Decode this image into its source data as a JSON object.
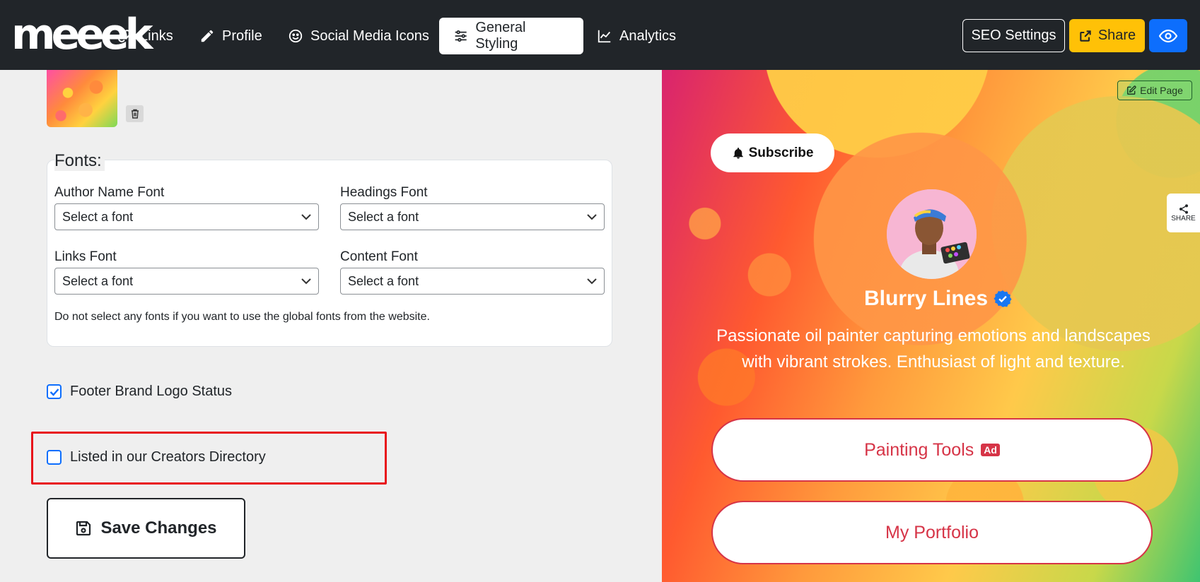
{
  "app": {
    "logo_text": "meeek"
  },
  "nav": {
    "links": "Links",
    "profile": "Profile",
    "social_media_icons": "Social Media Icons",
    "general_styling": "General Styling",
    "analytics": "Analytics"
  },
  "toolbar": {
    "seo_settings": "SEO Settings",
    "share": "Share"
  },
  "fonts": {
    "legend": "Fonts:",
    "author_name_label": "Author Name Font",
    "author_name_value": "Select a font",
    "headings_label": "Headings Font",
    "headings_value": "Select a font",
    "links_label": "Links Font",
    "links_value": "Select a font",
    "content_label": "Content Font",
    "content_value": "Select a font",
    "note": "Do not select any fonts if you want to use the global fonts from the website."
  },
  "options": {
    "footer_brand_logo_label": "Footer Brand Logo Status",
    "footer_brand_logo_checked": true,
    "creators_directory_label": "Listed in our Creators Directory",
    "creators_directory_checked": false
  },
  "save_label": "Save Changes",
  "preview": {
    "edit_page": "Edit Page",
    "subscribe": "Subscribe",
    "share_tab": "SHARE",
    "author_name": "Blurry Lines",
    "bio": "Passionate oil painter capturing emotions and landscapes with vibrant strokes. Enthusiast of light and texture.",
    "links": [
      {
        "label": "Painting Tools",
        "badge": "Ad"
      },
      {
        "label": "My Portfolio"
      }
    ]
  },
  "colors": {
    "accent": "#0d6efd",
    "warning": "#ffc107",
    "link_red": "#d63447",
    "highlight": "#e8131b",
    "navbar": "#212529"
  }
}
